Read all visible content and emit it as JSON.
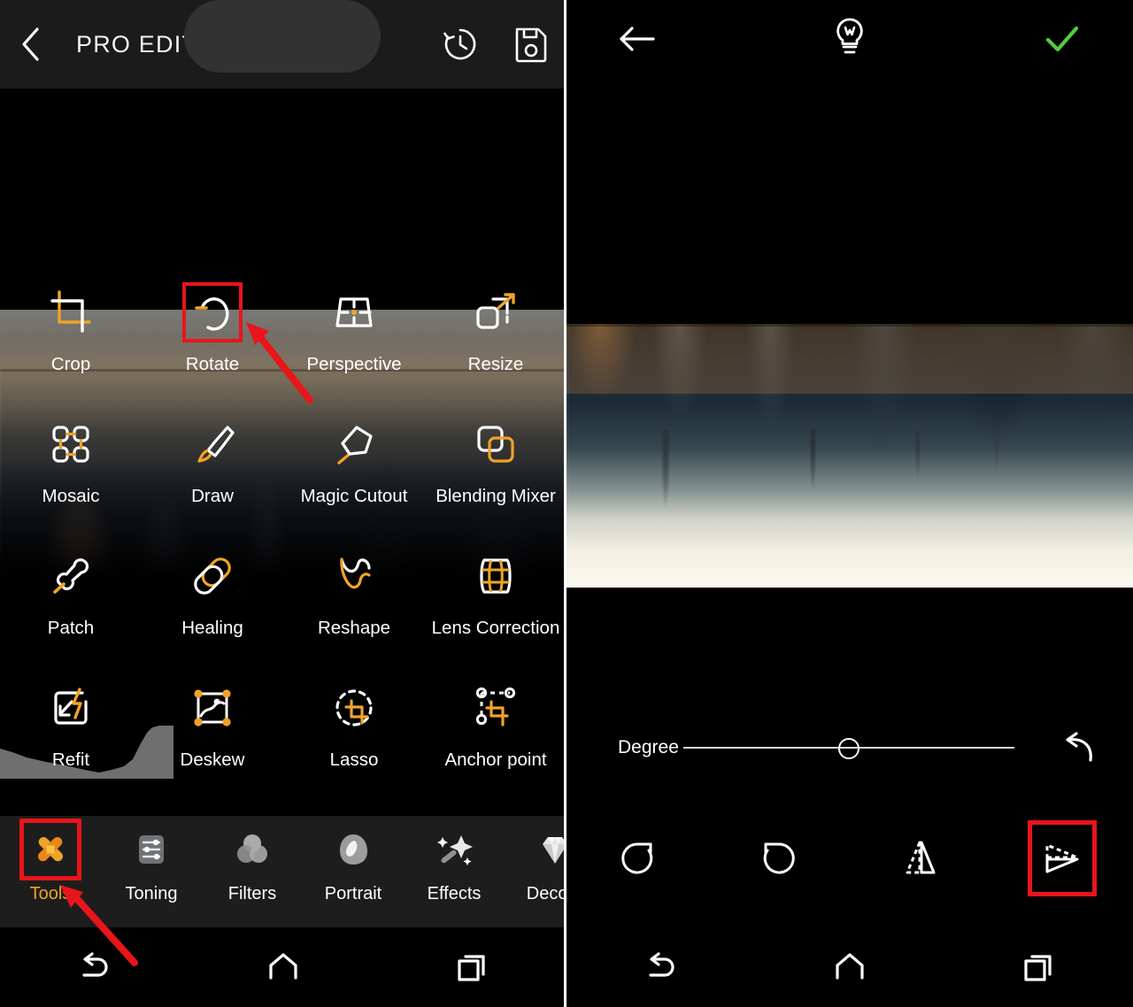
{
  "colors": {
    "accent_orange": "#f0a32a",
    "highlight_red": "#e8151a",
    "confirm_green": "#4fce3d",
    "appbar_bg": "#1b1b1b",
    "tabbar_bg": "#1d1d1d"
  },
  "left_panel": {
    "appbar": {
      "back_icon": "chevron-left-icon",
      "title": "PRO EDITING",
      "history_icon": "history-clock-icon",
      "save_icon": "save-floppy-icon"
    },
    "tools": [
      {
        "label": "Crop",
        "icon": "crop-icon",
        "highlighted": true
      },
      {
        "label": "Rotate",
        "icon": "rotate-icon",
        "highlighted": true
      },
      {
        "label": "Perspective",
        "icon": "perspective-icon",
        "highlighted": false
      },
      {
        "label": "Resize",
        "icon": "resize-icon",
        "highlighted": false
      },
      {
        "label": "Mosaic",
        "icon": "mosaic-icon",
        "highlighted": false
      },
      {
        "label": "Draw",
        "icon": "draw-brush-icon",
        "highlighted": false
      },
      {
        "label": "Magic Cutout",
        "icon": "magic-cutout-icon",
        "highlighted": false
      },
      {
        "label": "Blending Mixer",
        "icon": "blending-mixer-icon",
        "highlighted": false
      },
      {
        "label": "Patch",
        "icon": "patch-stamp-icon",
        "highlighted": false
      },
      {
        "label": "Healing",
        "icon": "healing-icon",
        "highlighted": false
      },
      {
        "label": "Reshape",
        "icon": "reshape-icon",
        "highlighted": false
      },
      {
        "label": "Lens Correction",
        "icon": "lens-correction-icon",
        "highlighted": false
      },
      {
        "label": "Refit",
        "icon": "refit-icon",
        "highlighted": false
      },
      {
        "label": "Deskew",
        "icon": "deskew-icon",
        "highlighted": false
      },
      {
        "label": "Lasso",
        "icon": "lasso-icon",
        "highlighted": false
      },
      {
        "label": "Anchor point",
        "icon": "anchor-point-icon",
        "highlighted": false
      }
    ],
    "tabs": [
      {
        "label": "Tools",
        "icon": "tools-x-icon",
        "active": true,
        "boxed": true
      },
      {
        "label": "Toning",
        "icon": "toning-sliders-icon",
        "active": false,
        "boxed": false
      },
      {
        "label": "Filters",
        "icon": "filters-circles-icon",
        "active": false,
        "boxed": false
      },
      {
        "label": "Portrait",
        "icon": "portrait-icon",
        "active": false,
        "boxed": false
      },
      {
        "label": "Effects",
        "icon": "effects-wand-icon",
        "active": false,
        "boxed": false
      },
      {
        "label": "Decora",
        "icon": "decoration-gem-icon",
        "active": false,
        "boxed": false
      }
    ],
    "navbar": [
      {
        "icon": "android-back-icon",
        "name": "nav-back"
      },
      {
        "icon": "android-home-icon",
        "name": "nav-home"
      },
      {
        "icon": "android-recents-icon",
        "name": "nav-recents"
      }
    ]
  },
  "right_panel": {
    "appbar": {
      "back_icon": "arrow-left-icon",
      "tips_icon": "lightbulb-icon",
      "confirm_icon": "check-icon"
    },
    "slider": {
      "label": "Degree",
      "value_position_percent": 50,
      "reset_icon": "undo-curved-arrow-icon"
    },
    "rotation_buttons": [
      {
        "icon": "rotate-right-icon",
        "name": "rotate-right-button",
        "boxed": false
      },
      {
        "icon": "rotate-left-icon",
        "name": "rotate-left-button",
        "boxed": false
      },
      {
        "icon": "flip-horizontal-icon",
        "name": "flip-horizontal-button",
        "boxed": false
      },
      {
        "icon": "flip-vertical-icon",
        "name": "flip-vertical-button",
        "boxed": true
      }
    ],
    "navbar": [
      {
        "icon": "android-back-icon",
        "name": "nav-back"
      },
      {
        "icon": "android-home-icon",
        "name": "nav-home"
      },
      {
        "icon": "android-recents-icon",
        "name": "nav-recents"
      }
    ]
  }
}
